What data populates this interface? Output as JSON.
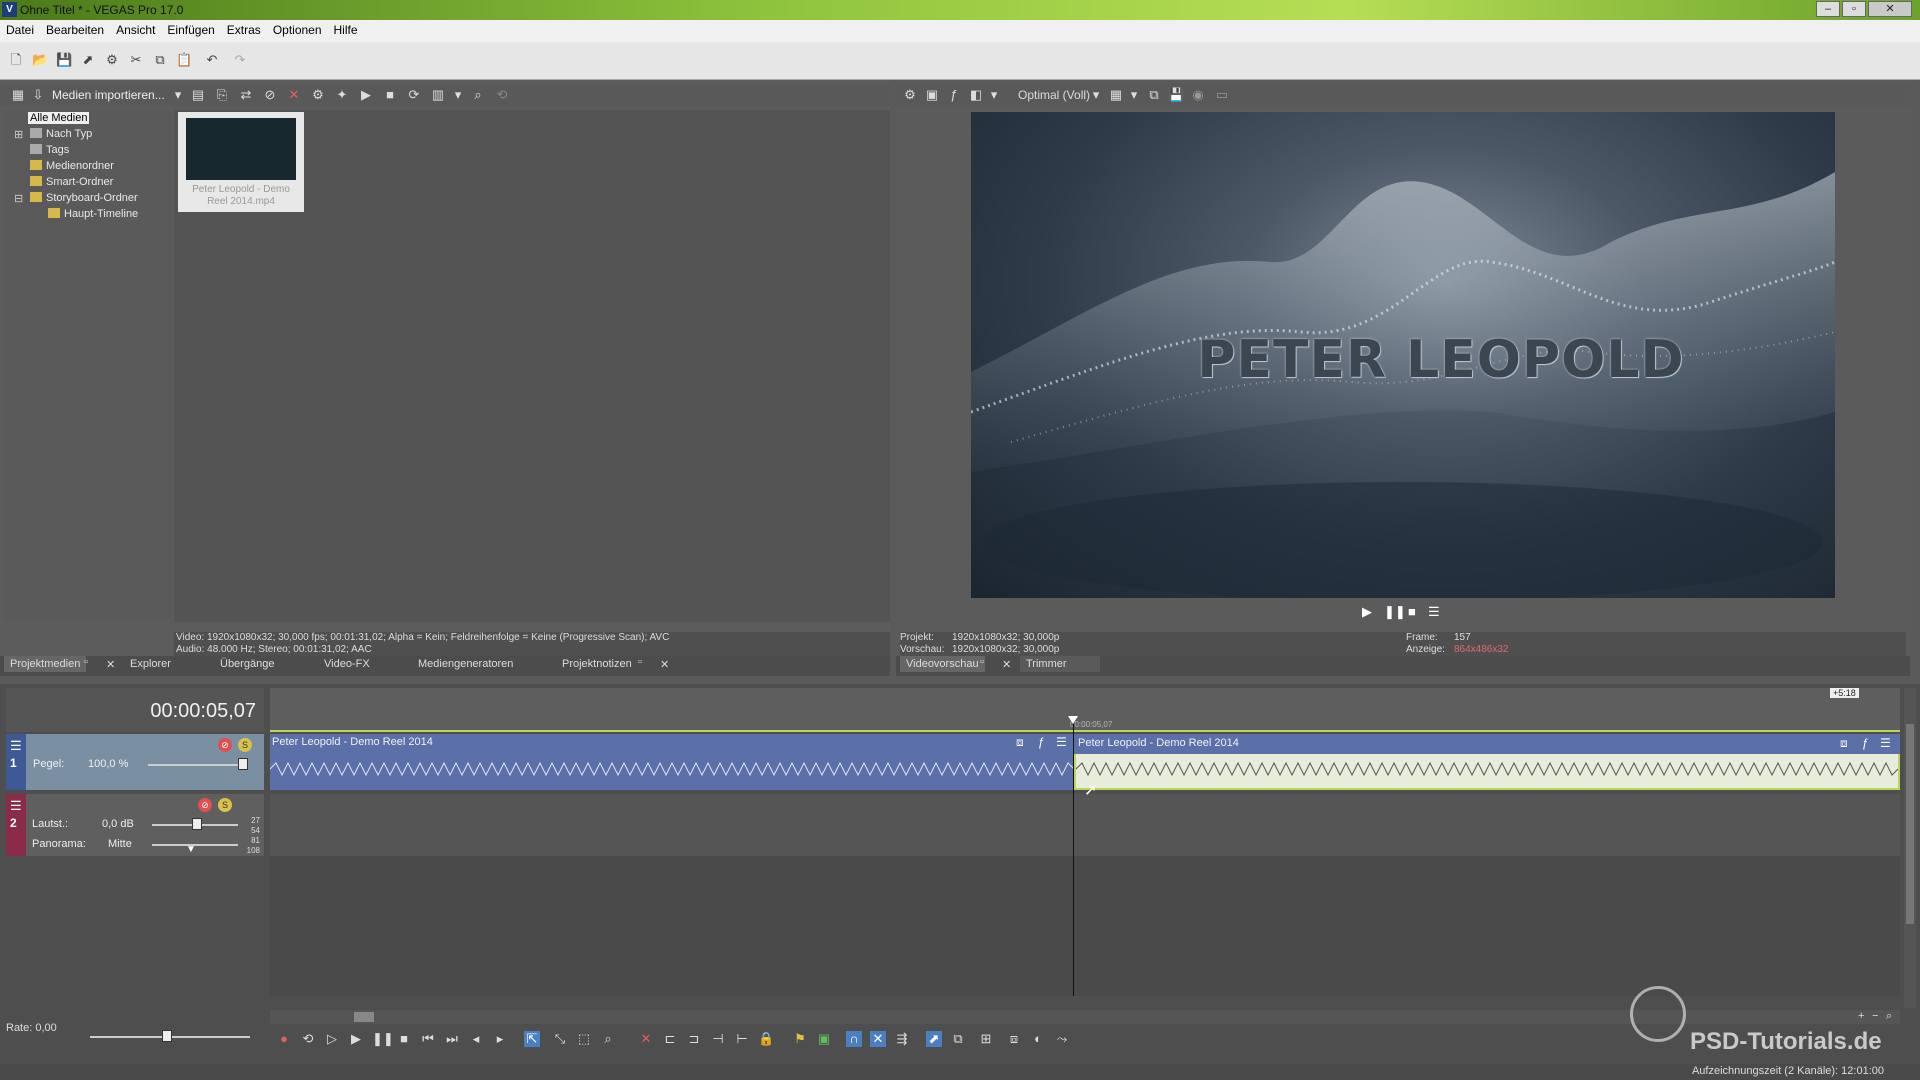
{
  "window": {
    "title": "Ohne Titel * - VEGAS Pro 17.0",
    "app_icon": "V",
    "controls": {
      "minimize": "–",
      "maximize": "▫",
      "close": "✕"
    }
  },
  "menu": [
    "Datei",
    "Bearbeiten",
    "Ansicht",
    "Einfügen",
    "Extras",
    "Optionen",
    "Hilfe"
  ],
  "media_panel": {
    "import_label": "Medien importieren...",
    "tree": [
      {
        "label": "Alle Medien",
        "selected": true
      },
      {
        "label": "Nach Typ"
      },
      {
        "label": "Tags"
      },
      {
        "label": "Medienordner"
      },
      {
        "label": "Smart-Ordner"
      },
      {
        "label": "Storyboard-Ordner"
      },
      {
        "label": "Haupt-Timeline"
      }
    ],
    "thumbnail_caption": "Peter Leopold - Demo Reel 2014.mp4",
    "info_video": "Video: 1920x1080x32; 30,000 fps; 00:01:31,02; Alpha = Kein; Feldreihenfolge = Keine (Progressive Scan); AVC",
    "info_audio": "Audio: 48.000 Hz; Stereo; 00:01:31,02; AAC",
    "tabs": [
      "Projektmedien",
      "Explorer",
      "Übergänge",
      "Video-FX",
      "Mediengeneratoren",
      "Projektnotizen"
    ]
  },
  "preview": {
    "quality": "Optimal (Voll)",
    "overlay_text": "PETER  LEOPOLD",
    "project_label": "Projekt:",
    "project_value": "1920x1080x32; 30,000p",
    "vorschau_label": "Vorschau:",
    "vorschau_value": "1920x1080x32; 30,000p",
    "frame_label": "Frame:",
    "frame_value": "157",
    "anzeige_label": "Anzeige:",
    "anzeige_value": "864x486x32",
    "tabs": [
      "Videovorschau",
      "Trimmer"
    ]
  },
  "timeline": {
    "timecode": "00:00:05,07",
    "cursor_time": "00:00:05,07",
    "speed_badge": "+5:18",
    "track1": {
      "number": "1",
      "level_label": "Pegel:",
      "level_value": "100,0 %"
    },
    "track2": {
      "number": "2",
      "volume_label": "Lautst.:",
      "volume_value": "0,0 dB",
      "pan_label": "Panorama:",
      "pan_value": "Mitte",
      "meter_ticks": [
        "27",
        "54",
        "81",
        "108"
      ]
    },
    "clip1": "Peter Leopold - Demo Reel 2014",
    "clip2": "Peter Leopold - Demo Reel 2014",
    "rate": "Rate: 0,00"
  },
  "status": {
    "record_time": "Aufzeichnungszeit (2 Kanäle): 12:01:00",
    "watermark": "PSD-Tutorials.de"
  },
  "colors": {
    "title_green": "#8ec43c",
    "track_blue": "#5b6fa8",
    "track2_red": "#8a2b4a",
    "clip_selected": "#b9d55a"
  }
}
